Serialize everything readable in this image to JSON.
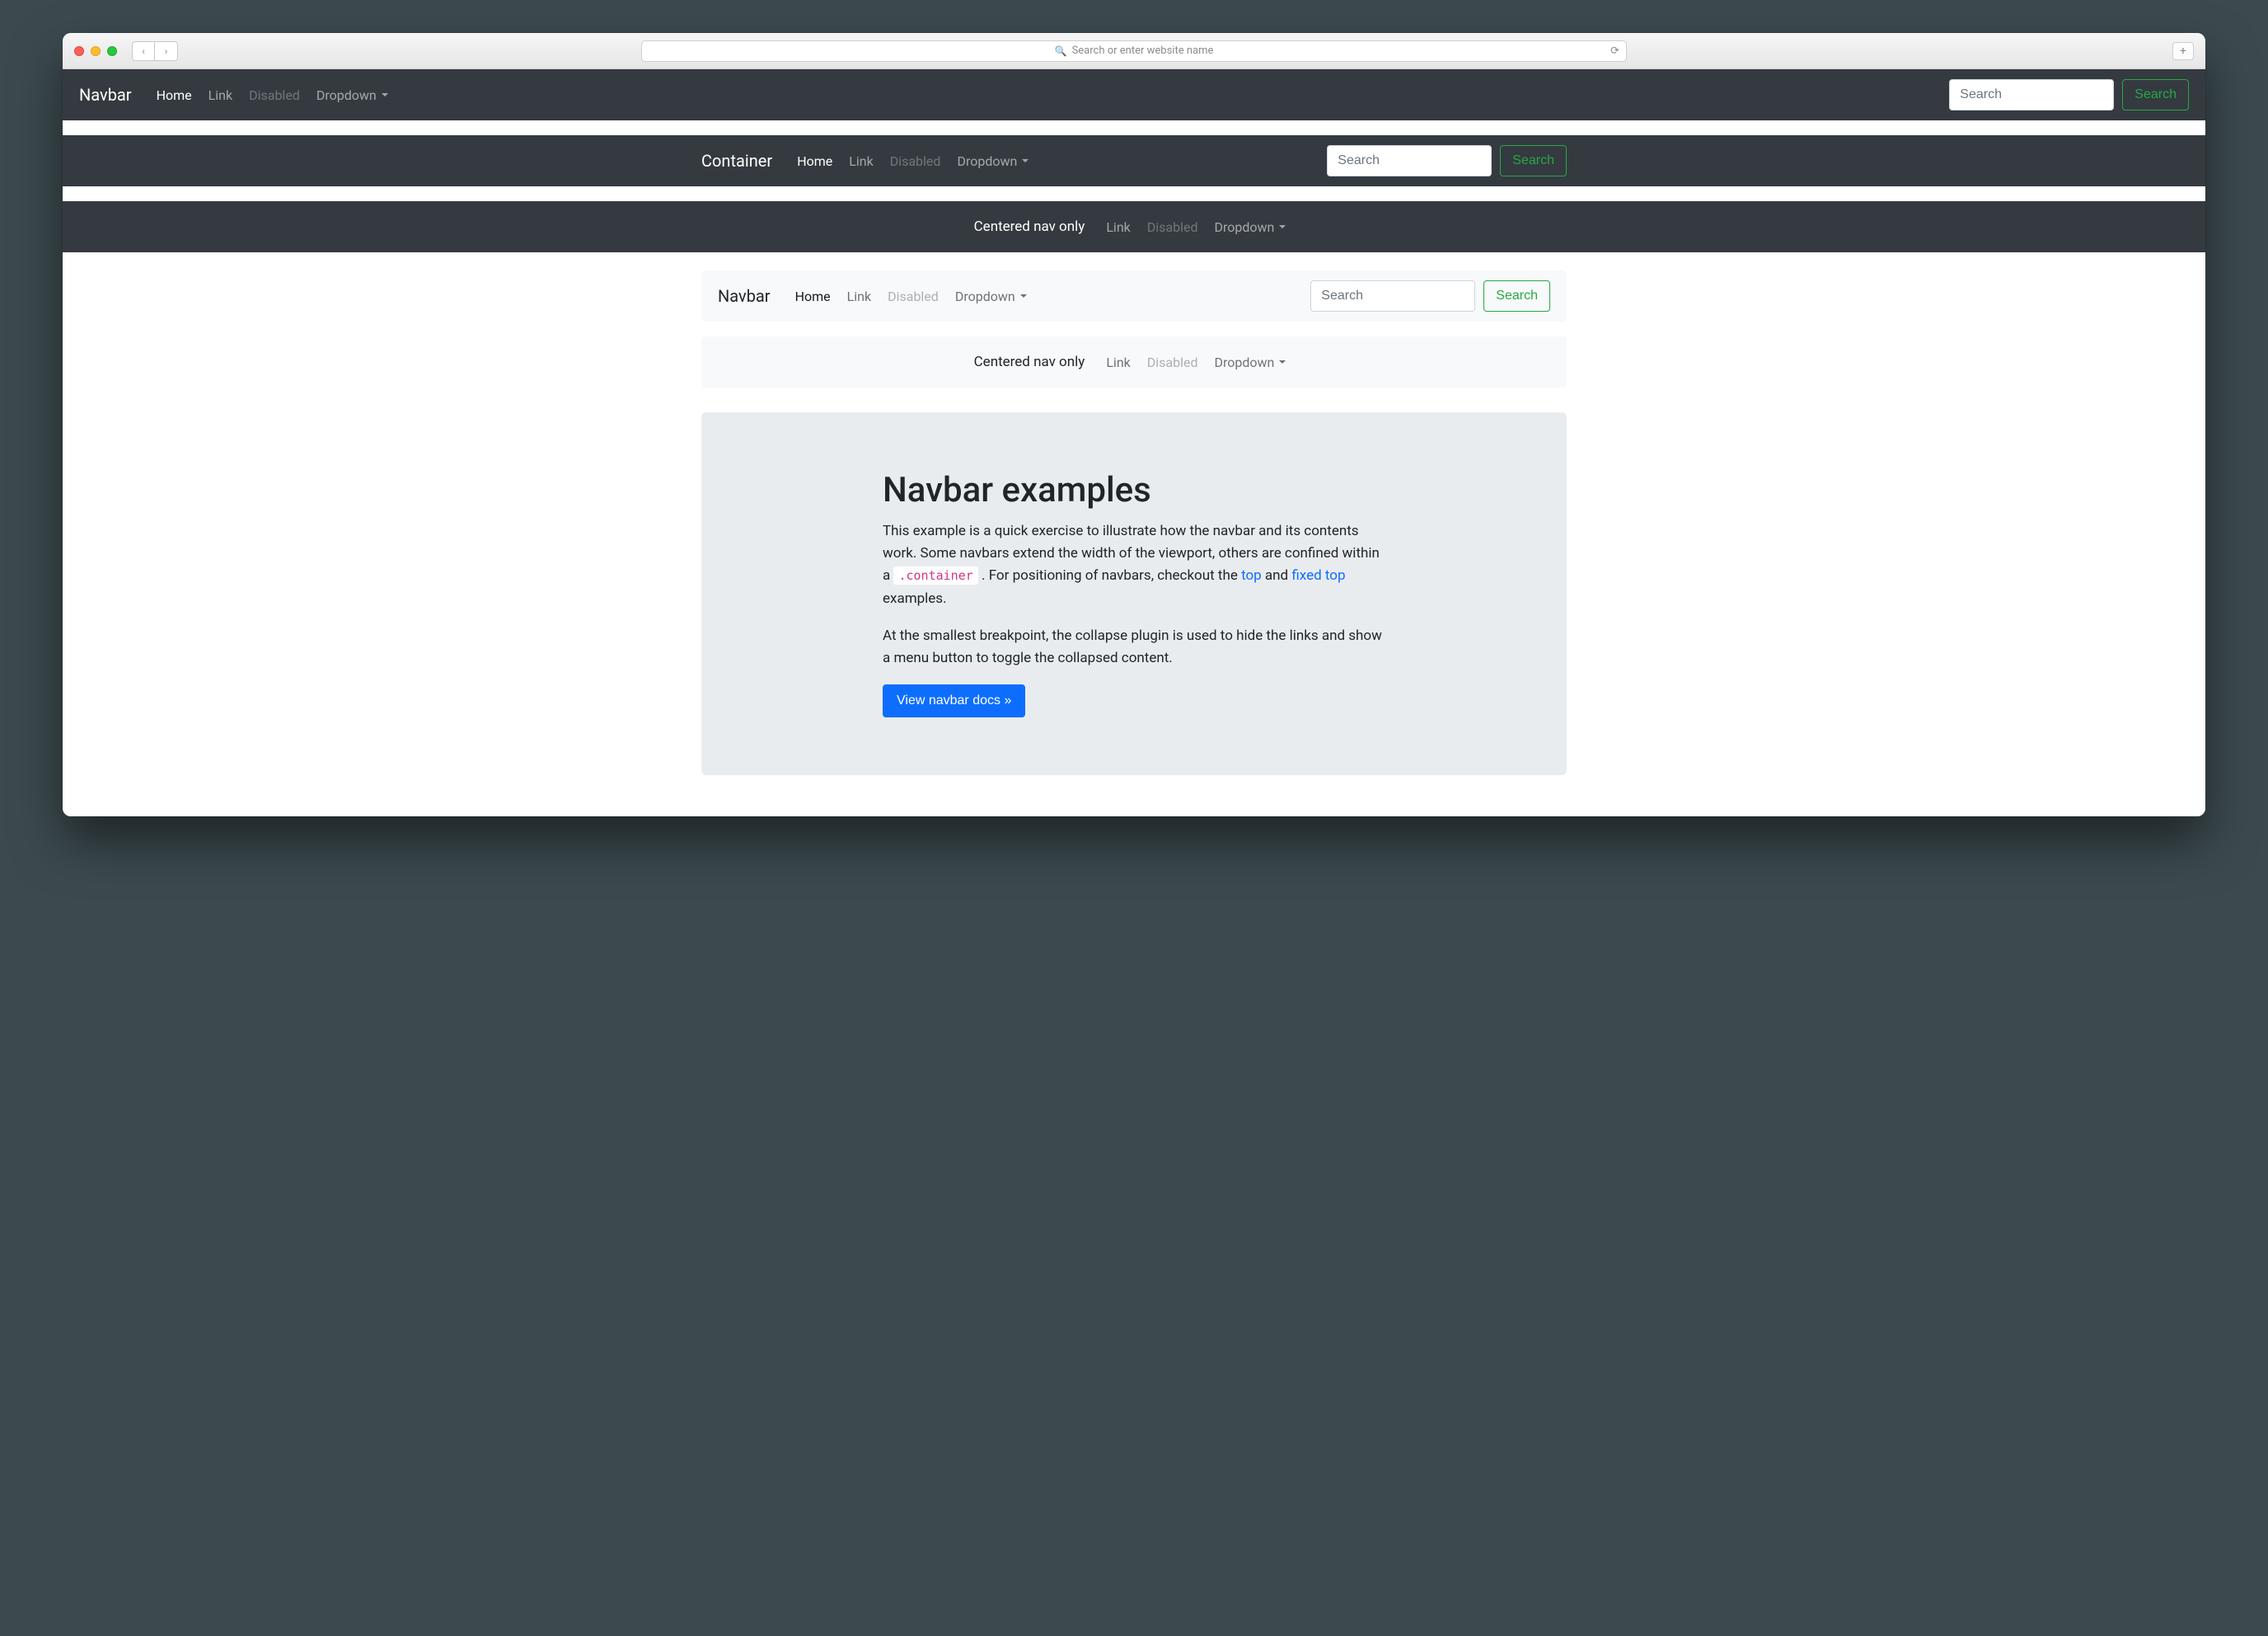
{
  "browser": {
    "address_placeholder": "Search or enter website name"
  },
  "nav": {
    "home": "Home",
    "link": "Link",
    "disabled": "Disabled",
    "dropdown": "Dropdown"
  },
  "brands": {
    "navbar": "Navbar",
    "container": "Container",
    "centered": "Centered nav only"
  },
  "search": {
    "placeholder": "Search",
    "button": "Search"
  },
  "jumbo": {
    "title": "Navbar examples",
    "p1a": "This example is a quick exercise to illustrate how the navbar and its contents work. Some navbars extend the width of the viewport, others are confined within a ",
    "code": ".container",
    "p1b": ". For positioning of navbars, checkout the ",
    "link_top": "top",
    "p1c": " and ",
    "link_fixed": "fixed top",
    "p1d": " examples.",
    "p2": "At the smallest breakpoint, the collapse plugin is used to hide the links and show a menu button to toggle the collapsed content.",
    "button": "View navbar docs »"
  }
}
